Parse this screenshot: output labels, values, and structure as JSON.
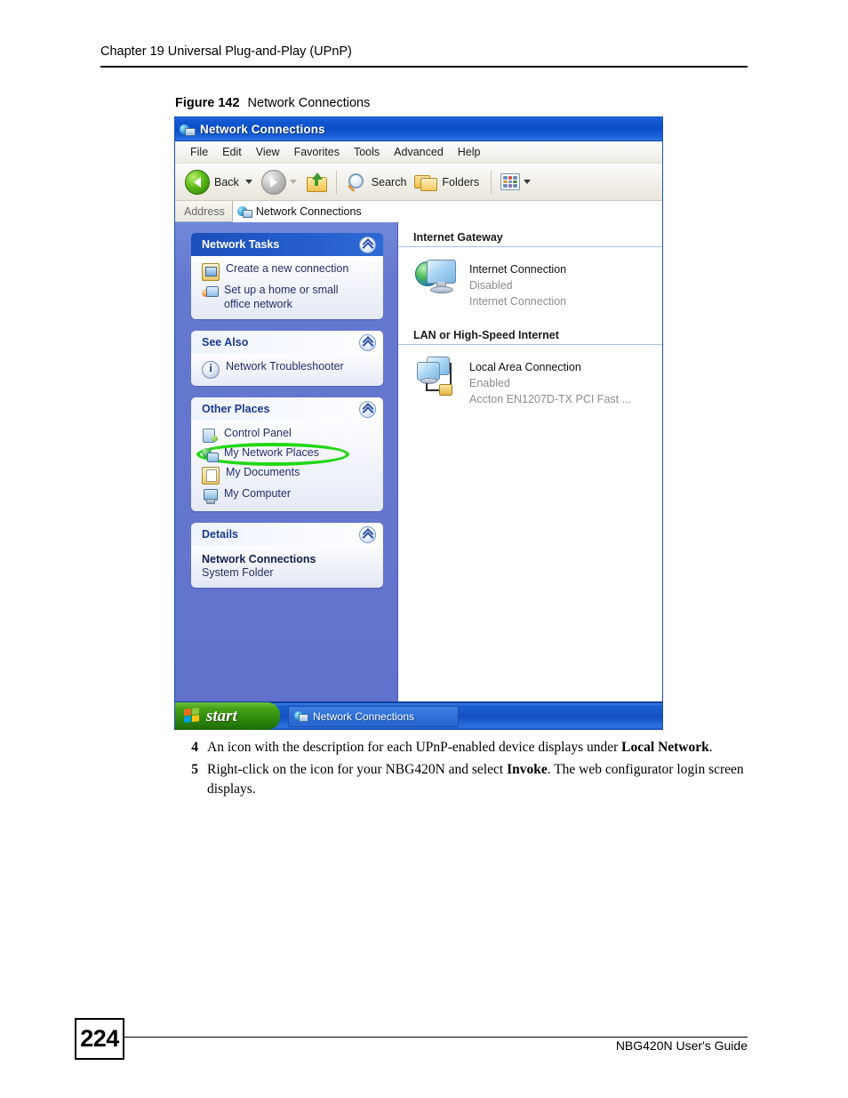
{
  "page": {
    "chapter_header": "Chapter 19 Universal Plug-and-Play (UPnP)",
    "page_number": "224",
    "footer_right": "NBG420N User's Guide"
  },
  "figure": {
    "label": "Figure 142",
    "title": "Network Connections"
  },
  "window": {
    "title": "Network Connections",
    "menu": [
      "File",
      "Edit",
      "View",
      "Favorites",
      "Tools",
      "Advanced",
      "Help"
    ],
    "toolbar": {
      "back_label": "Back",
      "search_label": "Search",
      "folders_label": "Folders"
    },
    "address": {
      "label": "Address",
      "value": "Network Connections"
    },
    "sidebar": {
      "panels": [
        {
          "title": "Network Tasks",
          "style": "dark",
          "items": [
            {
              "label": "Create a new connection",
              "icon": "new-connection-icon"
            },
            {
              "label": "Set up a home or small office network",
              "icon": "home-network-icon"
            }
          ]
        },
        {
          "title": "See Also",
          "style": "light",
          "items": [
            {
              "label": "Network Troubleshooter",
              "icon": "info-icon"
            }
          ]
        },
        {
          "title": "Other Places",
          "style": "light",
          "items": [
            {
              "label": "Control Panel",
              "icon": "control-panel-icon"
            },
            {
              "label": "My Network Places",
              "icon": "my-network-places-icon",
              "highlighted": true
            },
            {
              "label": "My Documents",
              "icon": "my-documents-icon"
            },
            {
              "label": "My Computer",
              "icon": "my-computer-icon"
            }
          ]
        },
        {
          "title": "Details",
          "style": "light",
          "detail_title": "Network Connections",
          "detail_subtitle": "System Folder"
        }
      ]
    },
    "content": {
      "groups": [
        {
          "header": "Internet Gateway",
          "items": [
            {
              "name": "Internet Connection",
              "status": "Disabled",
              "device": "Internet Connection"
            }
          ]
        },
        {
          "header": "LAN or High-Speed Internet",
          "items": [
            {
              "name": "Local Area Connection",
              "status": "Enabled",
              "device": "Accton EN1207D-TX PCI Fast ..."
            }
          ]
        }
      ]
    },
    "taskbar": {
      "start_label": "start",
      "task_label": "Network Connections"
    }
  },
  "steps": [
    {
      "number": "4",
      "parts": [
        {
          "text": "An icon with the description for each UPnP-enabled device displays under ",
          "bold": false
        },
        {
          "text": "Local Network",
          "bold": true
        },
        {
          "text": ".",
          "bold": false
        }
      ]
    },
    {
      "number": "5",
      "parts": [
        {
          "text": "Right-click on the icon for your NBG420N and select ",
          "bold": false
        },
        {
          "text": "Invoke",
          "bold": true
        },
        {
          "text": ". The web configurator login screen displays.",
          "bold": false
        }
      ]
    }
  ],
  "colors": {
    "titlebar_blue": "#0b4ec9",
    "sidebar_blue": "#6375cd",
    "highlight_green": "#22d715",
    "panel_header_dark": "#2159c8",
    "panel_header_text_light": "#1a3a8f"
  }
}
